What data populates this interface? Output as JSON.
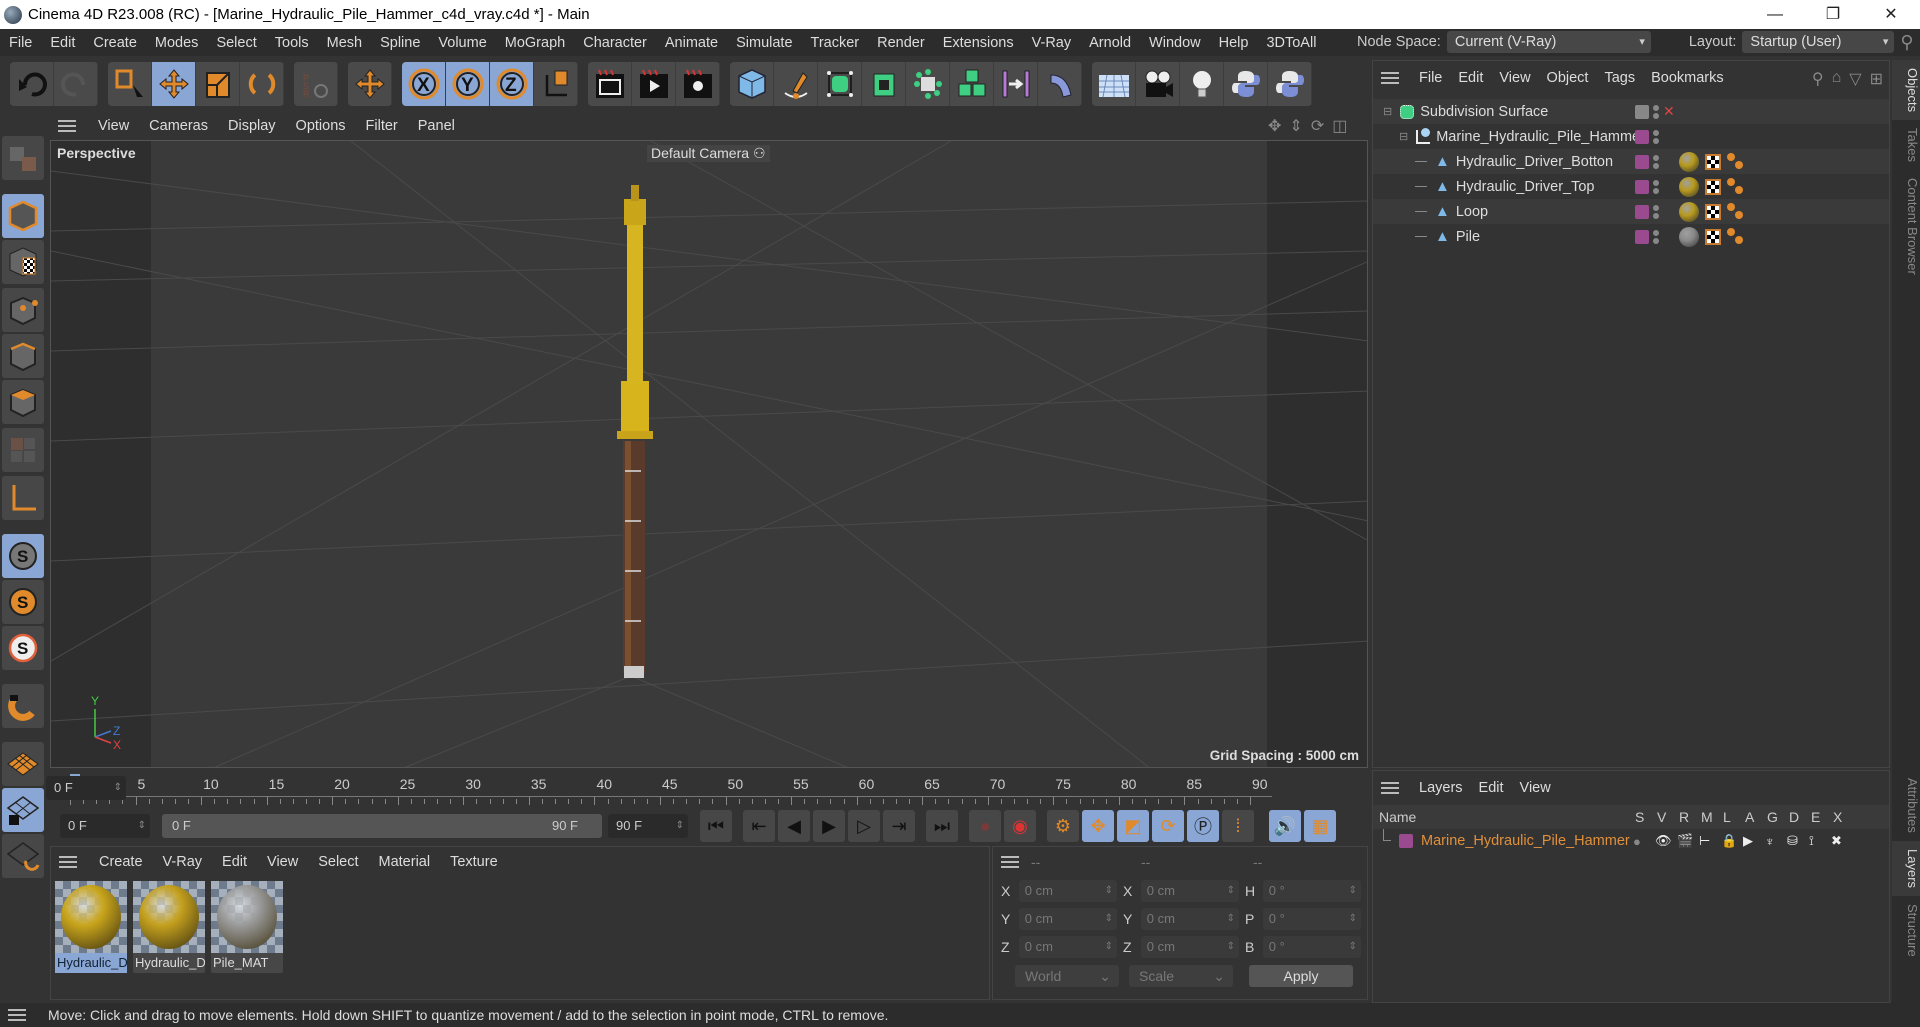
{
  "window": {
    "title": "Cinema 4D R23.008 (RC) - [Marine_Hydraulic_Pile_Hammer_c4d_vray.c4d *] - Main",
    "controls": [
      "minimize",
      "restore",
      "close"
    ]
  },
  "menubar": {
    "items": [
      "File",
      "Edit",
      "Create",
      "Modes",
      "Select",
      "Tools",
      "Mesh",
      "Spline",
      "Volume",
      "MoGraph",
      "Character",
      "Animate",
      "Simulate",
      "Tracker",
      "Render",
      "Extensions",
      "V-Ray",
      "Arnold",
      "Window",
      "Help",
      "3DToAll"
    ],
    "node_space_label": "Node Space:",
    "node_space_value": "Current (V-Ray)",
    "layout_label": "Layout:",
    "layout_value": "Startup (User)"
  },
  "toolbar": {
    "groups": [
      [
        "undo-icon",
        "redo-icon"
      ],
      [
        "live-selection-icon",
        "move-icon",
        "scale-icon",
        "rotate-icon"
      ],
      [
        "psr-icon"
      ],
      [
        "transform-icon"
      ],
      [
        "x-axis-icon",
        "y-axis-icon",
        "z-axis-icon",
        "coordinate-system-icon"
      ],
      [
        "render-view-icon",
        "render-picture-viewer-icon",
        "render-settings-icon"
      ],
      [
        "cube-icon",
        "pen-icon",
        "subdivision-icon",
        "extrude-icon",
        "deformer-icon",
        "cloner-icon",
        "field-icon",
        "bend-icon"
      ],
      [
        "floor-icon",
        "camera-icon",
        "light-icon",
        "python-icon",
        "python-icon-2"
      ]
    ],
    "active": [
      "move-icon",
      "x-axis-icon",
      "y-axis-icon",
      "z-axis-icon"
    ]
  },
  "left_tools": [
    "make-editable-icon",
    "model-mode-icon",
    "texture-mode-icon",
    "point-mode-icon",
    "edge-mode-icon",
    "polygon-mode-icon",
    "uv-mode-icon",
    "axis-mode-icon",
    "solo-off-icon",
    "solo-icon",
    "solo-hierarchy-icon",
    "snap-icon",
    "workplane-icon",
    "locked-workplane-icon",
    "workplane-sync-icon"
  ],
  "viewport": {
    "menu": [
      "View",
      "Cameras",
      "Display",
      "Options",
      "Filter",
      "Panel"
    ],
    "label": "Perspective",
    "camera": "Default Camera",
    "grid_spacing": "Grid Spacing : 5000 cm",
    "axis": {
      "y": "Y",
      "z": "Z",
      "x": "X"
    }
  },
  "timeline": {
    "ticks": [
      "0",
      "5",
      "10",
      "15",
      "20",
      "25",
      "30",
      "35",
      "40",
      "45",
      "50",
      "55",
      "60",
      "65",
      "70",
      "75",
      "80",
      "85",
      "90"
    ],
    "current_frame": "0 F"
  },
  "transport": {
    "start_field": "0 F",
    "range_start": "0 F",
    "range_end": "90 F",
    "end_field": "90 F"
  },
  "materials": {
    "menu": [
      "Create",
      "V-Ray",
      "Edit",
      "View",
      "Select",
      "Material",
      "Texture"
    ],
    "items": [
      {
        "name": "Hydraulic_D",
        "color": "#c9a51c",
        "selected": true
      },
      {
        "name": "Hydraulic_D",
        "color": "#c4a01e",
        "selected": false
      },
      {
        "name": "Pile_MAT",
        "color": "#9a9a9a",
        "selected": false
      }
    ]
  },
  "coordinates": {
    "headers": [
      "--",
      "--",
      "--"
    ],
    "rows": [
      {
        "l1": "X",
        "v1": "0 cm",
        "l2": "X",
        "v2": "0 cm",
        "l3": "H",
        "v3": "0 °"
      },
      {
        "l1": "Y",
        "v1": "0 cm",
        "l2": "Y",
        "v2": "0 cm",
        "l3": "P",
        "v3": "0 °"
      },
      {
        "l1": "Z",
        "v1": "0 cm",
        "l2": "Z",
        "v2": "0 cm",
        "l3": "B",
        "v3": "0 °"
      }
    ],
    "space": "World",
    "mode": "Scale",
    "apply": "Apply"
  },
  "objects": {
    "menu": [
      "File",
      "Edit",
      "View",
      "Object",
      "Tags",
      "Bookmarks"
    ],
    "tree": [
      {
        "name": "Subdivision Surface",
        "depth": 0,
        "type": "subdivision"
      },
      {
        "name": "Marine_Hydraulic_Pile_Hammer",
        "depth": 1,
        "type": "null"
      },
      {
        "name": "Hydraulic_Driver_Botton",
        "depth": 2,
        "type": "polygon",
        "mat": "#b89a1c"
      },
      {
        "name": "Hydraulic_Driver_Top",
        "depth": 2,
        "type": "polygon",
        "mat": "#b89a1c"
      },
      {
        "name": "Loop",
        "depth": 2,
        "type": "polygon",
        "mat": "#b89a1c"
      },
      {
        "name": "Pile",
        "depth": 2,
        "type": "polygon",
        "mat": "#8a8a8a"
      }
    ]
  },
  "layers": {
    "menu": [
      "Layers",
      "Edit",
      "View"
    ],
    "columns": [
      "Name",
      "S",
      "V",
      "R",
      "M",
      "L",
      "A",
      "G",
      "D",
      "E",
      "X"
    ],
    "items": [
      {
        "name": "Marine_Hydraulic_Pile_Hammer",
        "color": "#9a4a8e"
      }
    ]
  },
  "side_tabs_top": [
    "Objects",
    "Takes",
    "Content Browser"
  ],
  "side_tabs_bottom": [
    "Attributes",
    "Layers",
    "Structure"
  ],
  "status": "Move: Click and drag to move elements. Hold down SHIFT to quantize movement / add to the selection in point mode, CTRL to remove.",
  "colors": {
    "accent": "#8aa6d4",
    "orange": "#e08a2b",
    "layer": "#9a4a8e",
    "layer_text": "#e0903a"
  }
}
